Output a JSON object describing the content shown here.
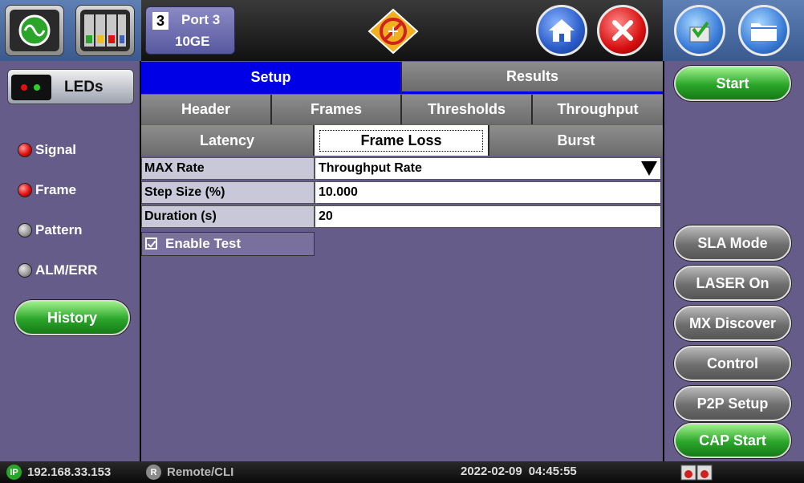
{
  "header": {
    "port_number": "3",
    "port_label": "Port 3",
    "port_rate": "10GE",
    "icons": [
      "test-app-icon",
      "modules-icon",
      "laser-warning-icon",
      "home-icon",
      "close-icon",
      "save-icon",
      "folder-icon"
    ]
  },
  "left_panel": {
    "leds_label": "LEDs",
    "indicators": [
      {
        "label": "Signal",
        "status": "red"
      },
      {
        "label": "Frame",
        "status": "red"
      },
      {
        "label": "Pattern",
        "status": "grey"
      },
      {
        "label": "ALM/ERR",
        "status": "grey"
      }
    ],
    "history_label": "History"
  },
  "tabs": {
    "main": [
      {
        "label": "Setup",
        "active": true
      },
      {
        "label": "Results",
        "active": false
      }
    ],
    "sub1": [
      "Header",
      "Frames",
      "Thresholds",
      "Throughput"
    ],
    "sub2": [
      {
        "label": "Latency",
        "active": false
      },
      {
        "label": "Frame Loss",
        "active": true
      },
      {
        "label": "Burst",
        "active": false
      }
    ]
  },
  "settings": {
    "rows": [
      {
        "label": "MAX Rate",
        "value": "Throughput Rate",
        "dropdown": true
      },
      {
        "label": "Step Size (%)",
        "value": "10.000",
        "dropdown": false
      },
      {
        "label": "Duration (s)",
        "value": "20",
        "dropdown": false
      }
    ],
    "enable_test_label": "Enable Test",
    "enable_test_checked": true
  },
  "right_panel": {
    "start_label": "Start",
    "buttons": [
      "SLA Mode",
      "LASER On",
      "MX Discover",
      "Control",
      "P2P Setup"
    ],
    "cap_start_label": "CAP Start"
  },
  "status_bar": {
    "ip_badge": "IP",
    "ip_address": "192.168.33.153",
    "remote_badge": "R",
    "remote_label": "Remote/CLI",
    "date": "2022-02-09",
    "time": "04:45:55"
  },
  "colors": {
    "panel_bg": "#655c8a",
    "active_tab": "#0000e6",
    "led_red": "#e01010",
    "pill_green": "#2aa52a"
  }
}
